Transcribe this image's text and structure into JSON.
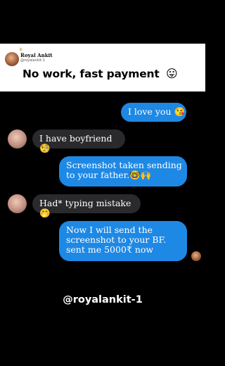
{
  "header": {
    "crown": "♛",
    "account_name": "Royal Ankit",
    "account_handle": "@royalankit-1",
    "headline": "No work, fast payment",
    "headline_emoji": "😛"
  },
  "chat": {
    "messages": [
      {
        "side": "sent",
        "text": "I love you 😘"
      },
      {
        "side": "received",
        "text": "I have boyfriend 🧐"
      },
      {
        "side": "sent",
        "text": "Screenshot taken sending to your father.🤓🙌"
      },
      {
        "side": "received",
        "text": "Had* typing mistake 🤭"
      },
      {
        "side": "sent",
        "text": "Now I will send the screenshot to your BF. sent me 5000₹ now"
      }
    ]
  },
  "watermark": "@royalankit-1",
  "colors": {
    "background": "#000000",
    "sent_bubble": "#1e88e5",
    "received_bubble": "#2a2a2c",
    "header_bg": "#ffffff"
  }
}
